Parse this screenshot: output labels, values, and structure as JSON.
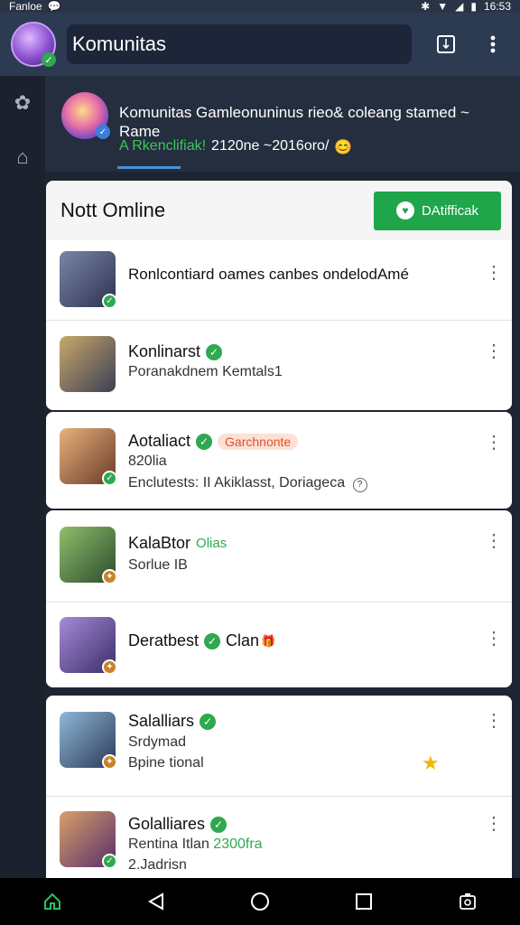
{
  "status_bar": {
    "left_text": "Fanloe",
    "time": "16:53"
  },
  "top_bar": {
    "title": "Komunitas"
  },
  "community": {
    "title": "Komunitas Gamleonuninus rieo& coleang stamed ~ Rame",
    "subtitle_green": "A Rkenclifiak!",
    "subtitle_rest": "2120ne ~2016oro/",
    "emoji": "😊"
  },
  "notifications": {
    "header_title": "Nott Omline",
    "header_button": "DAtifficak"
  },
  "items": [
    {
      "name": "Ronlcontiard oames canbes ondelodAmé",
      "line1": "",
      "line2": "",
      "tag": ""
    },
    {
      "name": "Konlinarst",
      "line1": "Poranakdnem Kemtals1",
      "line2": "",
      "tag": ""
    },
    {
      "name": "Aotaliact",
      "tag": "Garchnonte",
      "line1": "820lia",
      "line2": "Enclutests: II Akiklasst, Doriageca"
    },
    {
      "name": "KalaBtor",
      "tag": "Olias",
      "line1": "Sorlue IB",
      "line2": ""
    },
    {
      "name": "Deratbest",
      "tag": "Clan",
      "line1": "",
      "line2": ""
    },
    {
      "name": "Salalliars",
      "line1": "Srdymad",
      "line2": "Bpine tional",
      "tag": ""
    },
    {
      "name": "Golalliares",
      "line1": "Rentina Itlan",
      "line1_green": "2300fra",
      "line2": "2.Jadrisn",
      "tag": ""
    }
  ],
  "colors": {
    "accent_green": "#1fa54a",
    "topbar_bg": "#2c3a52",
    "badge_orange": "#e1542a"
  }
}
